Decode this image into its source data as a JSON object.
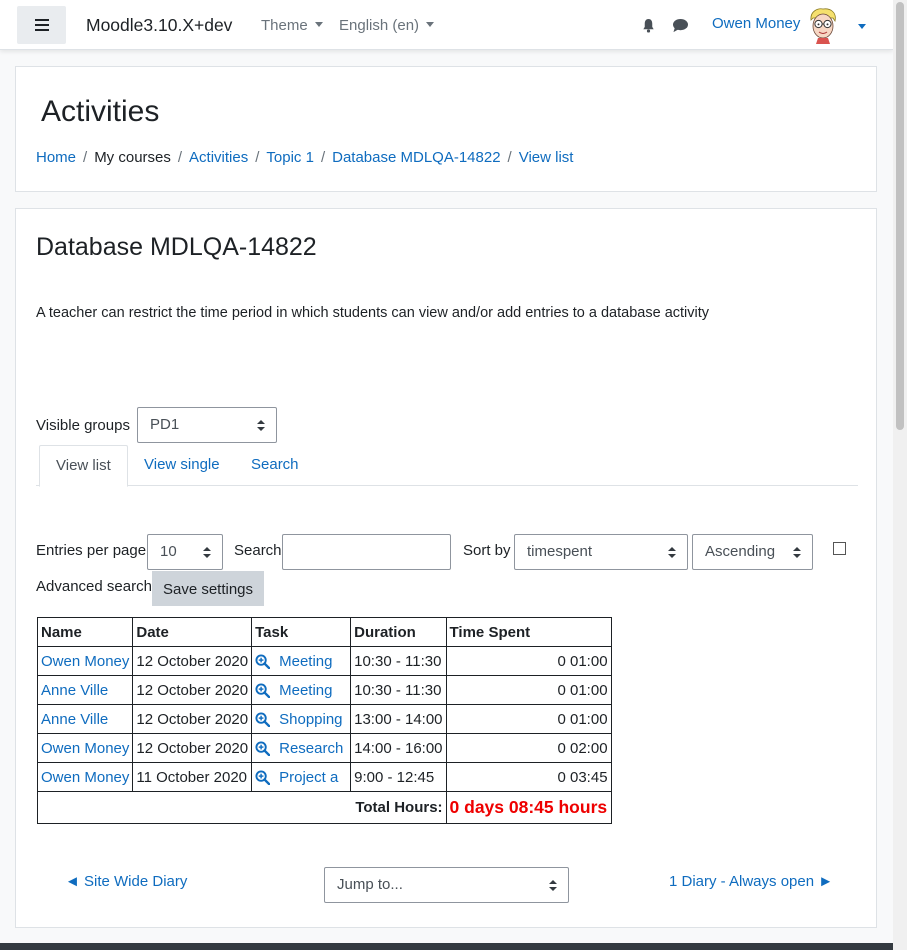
{
  "navbar": {
    "site_name": "Moodle3.10.X+dev",
    "theme_label": "Theme",
    "language_label": "English (en)",
    "user_name": "Owen Money"
  },
  "header": {
    "title": "Activities",
    "breadcrumb": {
      "home": "Home",
      "my_courses": "My courses",
      "activities": "Activities",
      "topic": "Topic 1",
      "database": "Database MDLQA-14822",
      "view_list": "View list",
      "separator": "/"
    }
  },
  "main": {
    "title": "Database MDLQA-14822",
    "intro": "A teacher can restrict the time period in which students can view and/or add entries to a database activity",
    "visible_groups_label": "Visible groups",
    "visible_groups_value": "PD1",
    "tabs": [
      {
        "label": "View list",
        "active": true
      },
      {
        "label": "View single",
        "active": false
      },
      {
        "label": "Search",
        "active": false
      }
    ],
    "settings": {
      "entries_per_page_label": "Entries per page",
      "entries_per_page_value": "10",
      "search_label": "Search",
      "search_value": "",
      "sort_by_label": "Sort by",
      "sort_by_value": "timespent",
      "order_value": "Ascending",
      "advanced_search_label": "Advanced search",
      "save_button": "Save settings"
    },
    "table": {
      "headers": [
        "Name",
        "Date",
        "Task",
        "Duration",
        "Time Spent"
      ],
      "rows": [
        {
          "name": "Owen Money",
          "date": "12 October 2020",
          "task": "Meeting",
          "duration": "10:30 - 11:30",
          "time_spent": "0 01:00"
        },
        {
          "name": "Anne Ville",
          "date": "12 October 2020",
          "task": "Meeting",
          "duration": "10:30 - 11:30",
          "time_spent": "0 01:00"
        },
        {
          "name": "Anne Ville",
          "date": "12 October 2020",
          "task": "Shopping",
          "duration": "13:00 - 14:00",
          "time_spent": "0 01:00"
        },
        {
          "name": "Owen Money",
          "date": "12 October 2020",
          "task": "Research",
          "duration": "14:00 - 16:00",
          "time_spent": "0 02:00"
        },
        {
          "name": "Owen Money",
          "date": "11 October 2020",
          "task": "Project a",
          "duration": "9:00 - 12:45",
          "time_spent": "0 03:45"
        }
      ],
      "total_label": "Total Hours:",
      "total_value": "0 days 08:45 hours"
    },
    "footer": {
      "prev_link": "◄ Site Wide Diary",
      "jump_to": "Jump to...",
      "next_link": "1 Diary - Always open ►"
    }
  },
  "colors": {
    "link": "#0f6cbf",
    "total_highlight": "#ee0000",
    "button_bg": "#ced4da"
  },
  "icons": [
    "menu-icon",
    "bell-icon",
    "chat-icon",
    "avatar",
    "magnifier-icon"
  ]
}
